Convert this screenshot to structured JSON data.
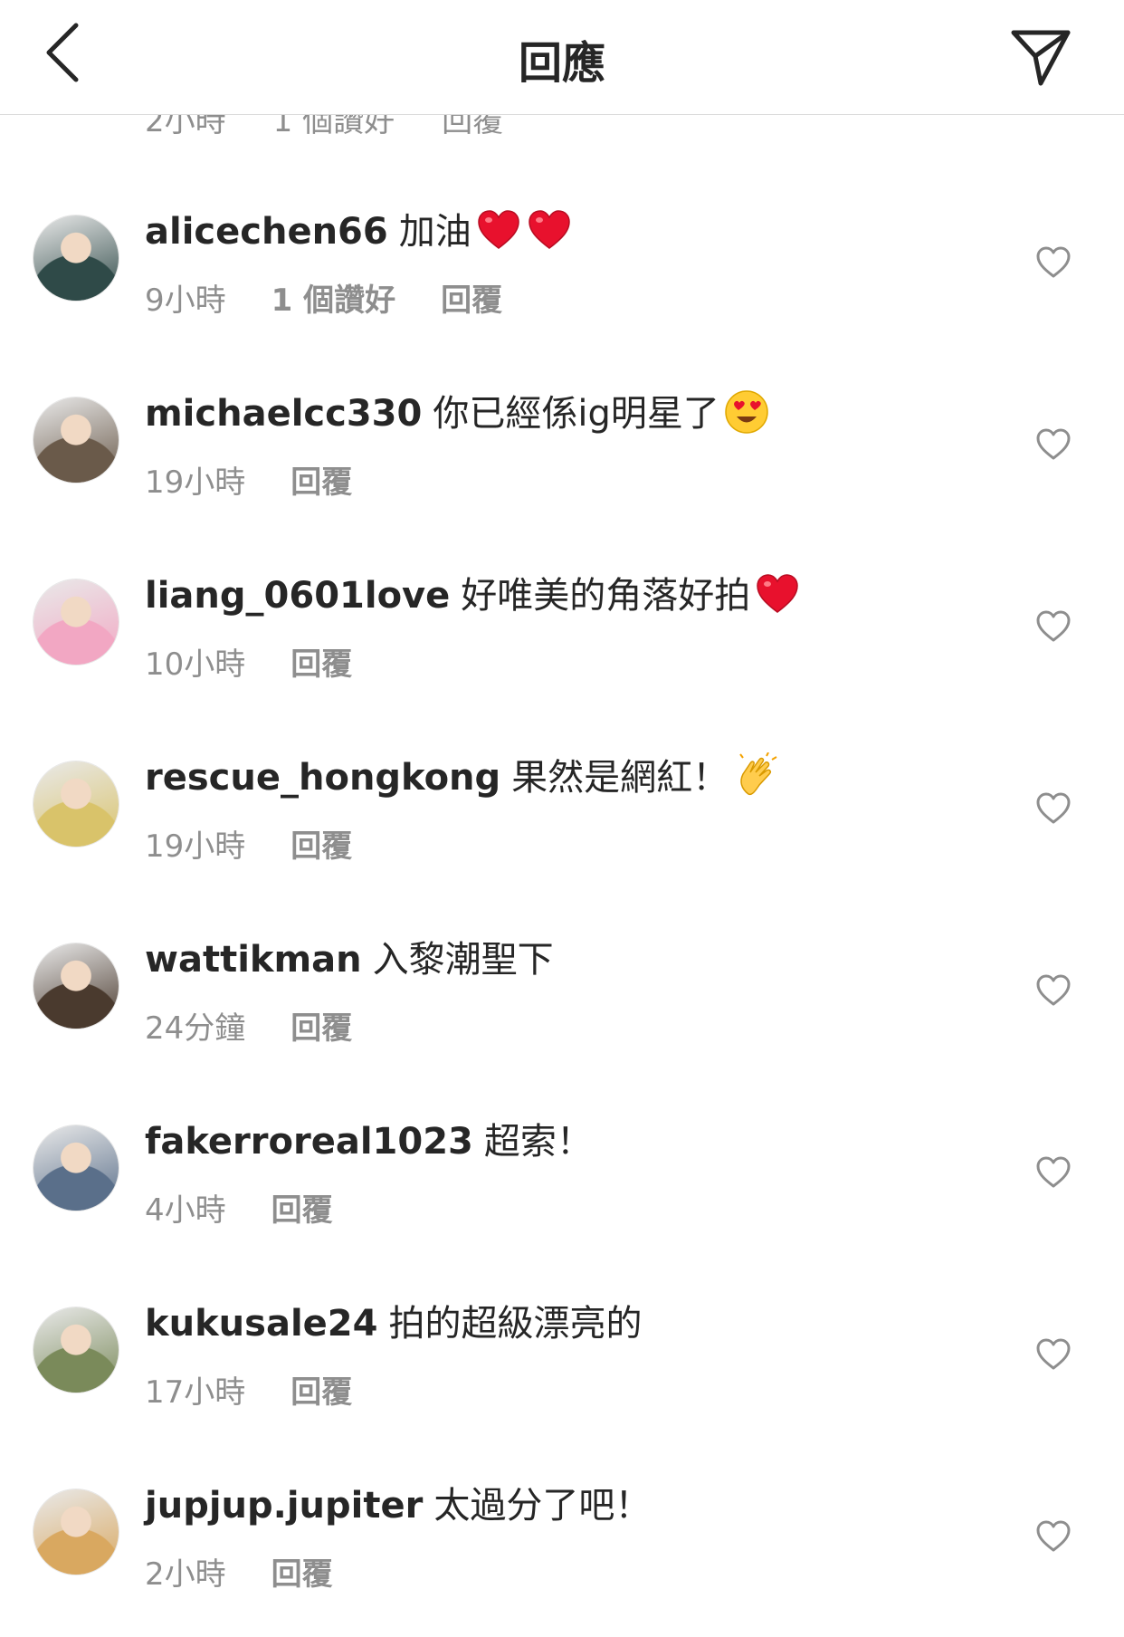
{
  "header": {
    "title": "回應"
  },
  "partial": {
    "time": "2小時",
    "likes": "1 個讚好",
    "reply": "回覆"
  },
  "comments": [
    {
      "username": "alicechen66",
      "text": "加油",
      "emoji": [
        "heart",
        "heart"
      ],
      "time": "9小時",
      "likes": "1 個讚好",
      "reply": "回覆",
      "avatar_color": "#2f4a48"
    },
    {
      "username": "michaelcc330",
      "text": "你已經係ig明星了",
      "emoji": [
        "heart-eyes"
      ],
      "time": "19小時",
      "likes": "",
      "reply": "回覆",
      "avatar_color": "#6a5a4a"
    },
    {
      "username": "liang_0601love",
      "text": "好唯美的角落好拍",
      "emoji": [
        "heart"
      ],
      "time": "10小時",
      "likes": "",
      "reply": "回覆",
      "avatar_color": "#f2a7c3"
    },
    {
      "username": "rescue_hongkong",
      "text": "果然是網紅！",
      "emoji": [
        "clap"
      ],
      "time": "19小時",
      "likes": "",
      "reply": "回覆",
      "avatar_color": "#d9c36a"
    },
    {
      "username": "wattikman",
      "text": "入黎潮聖下",
      "emoji": [],
      "time": "24分鐘",
      "likes": "",
      "reply": "回覆",
      "avatar_color": "#4a3a2e"
    },
    {
      "username": "fakerroreal1023",
      "text": "超索！",
      "emoji": [],
      "time": "4小時",
      "likes": "",
      "reply": "回覆",
      "avatar_color": "#5a6f8a"
    },
    {
      "username": "kukusale24",
      "text": "拍的超級漂亮的",
      "emoji": [],
      "time": "17小時",
      "likes": "",
      "reply": "回覆",
      "avatar_color": "#7a8a5a"
    },
    {
      "username": "jupjup.jupiter",
      "text": "太過分了吧！",
      "emoji": [],
      "time": "2小時",
      "likes": "",
      "reply": "回覆",
      "avatar_color": "#d9a860"
    }
  ],
  "icons": {
    "back": "chevron-left-icon",
    "send": "paper-plane-icon",
    "like": "heart-outline-icon"
  }
}
